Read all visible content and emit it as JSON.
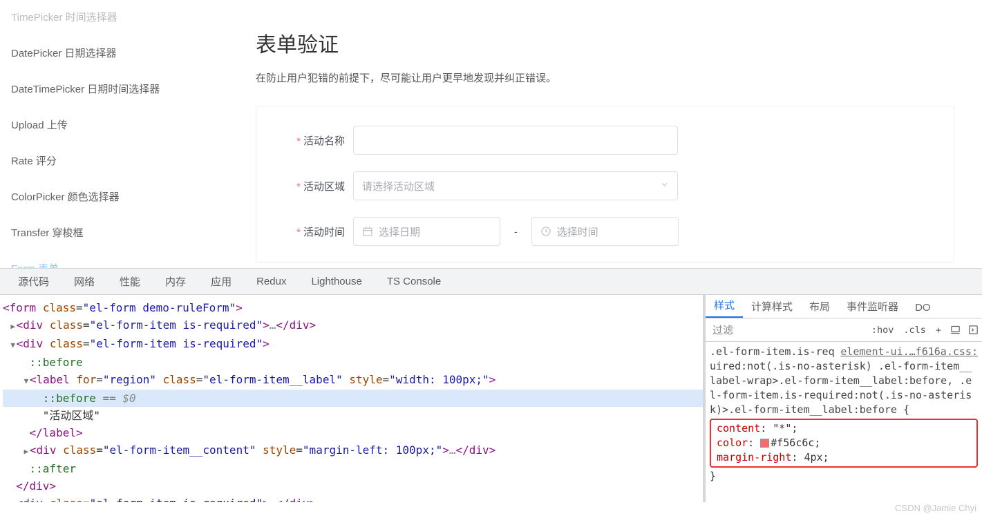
{
  "sidebar": {
    "items": [
      {
        "label": "TimePicker 时间选择器",
        "active": false,
        "faded": true
      },
      {
        "label": "DatePicker 日期选择器",
        "active": false,
        "faded": false
      },
      {
        "label": "DateTimePicker 日期时间选择器",
        "active": false,
        "faded": false
      },
      {
        "label": "Upload 上传",
        "active": false,
        "faded": false
      },
      {
        "label": "Rate 评分",
        "active": false,
        "faded": false
      },
      {
        "label": "ColorPicker 颜色选择器",
        "active": false,
        "faded": false
      },
      {
        "label": "Transfer 穿梭框",
        "active": false,
        "faded": false
      },
      {
        "label": "Form 表单",
        "active": true,
        "faded": false
      }
    ]
  },
  "main": {
    "title": "表单验证",
    "desc": "在防止用户犯错的前提下，尽可能让用户更早地发现并纠正错误。",
    "form": {
      "name_label": "活动名称",
      "region_label": "活动区域",
      "region_placeholder": "请选择活动区域",
      "time_label": "活动时间",
      "date_placeholder": "选择日期",
      "time_placeholder": "选择时间",
      "dash": "-"
    }
  },
  "devtools": {
    "tabs": [
      "源代码",
      "网络",
      "性能",
      "内存",
      "应用",
      "Redux",
      "Lighthouse",
      "TS Console"
    ],
    "dom": {
      "l1": {
        "open": "<",
        "tag": "form",
        "sp": " ",
        "a1": "class",
        "eq": "=",
        "v1": "\"el-form demo-ruleForm\"",
        "close": ">"
      },
      "l2": {
        "tri": "▶",
        "open": "<",
        "tag": "div",
        "sp": " ",
        "a1": "class",
        "eq": "=",
        "v1": "\"el-form-item is-required\"",
        "close": ">",
        "dots": "…",
        "copen": "</",
        "ctag": "div",
        "cclose": ">"
      },
      "l3": {
        "tri": "▼",
        "open": "<",
        "tag": "div",
        "sp": " ",
        "a1": "class",
        "eq": "=",
        "v1": "\"el-form-item is-required\"",
        "close": ">"
      },
      "l4": {
        "ps": "::before"
      },
      "l5": {
        "tri": "▼",
        "open": "<",
        "tag": "label",
        "sp": " ",
        "a1": "for",
        "eq": "=",
        "v1": "\"region\"",
        "sp2": " ",
        "a2": "class",
        "v2": "\"el-form-item__label\"",
        "sp3": " ",
        "a3": "style",
        "v3": "\"width: 100px;\"",
        "close": ">"
      },
      "l6": {
        "ps": "::before",
        "eq": " == ",
        "sel": "$0"
      },
      "l7": {
        "txt": "\"活动区域\""
      },
      "l8": {
        "copen": "</",
        "ctag": "label",
        "cclose": ">"
      },
      "l9": {
        "tri": "▶",
        "open": "<",
        "tag": "div",
        "sp": " ",
        "a1": "class",
        "eq": "=",
        "v1": "\"el-form-item__content\"",
        "sp2": " ",
        "a2": "style",
        "v2": "\"margin-left: 100px;\"",
        "close": ">",
        "dots": "…",
        "copen": "</",
        "ctag": "div",
        "cclose": ">"
      },
      "l10": {
        "ps": "::after"
      },
      "l11": {
        "copen": "</",
        "ctag": "div",
        "cclose": ">"
      },
      "l12": {
        "tri": "▶",
        "open": "<",
        "tag": "div",
        "sp": " ",
        "a1": "class",
        "eq": "=",
        "v1": "\"el-form-item is-required\"",
        "close": ">",
        "dots": "…",
        "copen": "</",
        "ctag": "div",
        "cclose": ">"
      }
    },
    "styles": {
      "tabs": [
        "样式",
        "计算样式",
        "布局",
        "事件监听器",
        "DO"
      ],
      "filter": "过滤",
      "hov": ":hov",
      "cls": ".cls",
      "plus": "+",
      "link": "element-ui.…f616a.css:",
      "selector": ".el-form-item.is-required:not(.is-no-asterisk) .el-form-item__label-wrap>.el-form-item__label:before, .el-form-item.is-required:not(.is-no-asterisk)>.el-form-item__label:before {",
      "rules": [
        {
          "prop": "content",
          "val": "\"*\";"
        },
        {
          "prop": "color",
          "val": "#f56c6c;",
          "swatch": true
        },
        {
          "prop": "margin-right",
          "val": "4px;"
        }
      ],
      "closeBrace": "}"
    }
  },
  "watermark": "CSDN @Jamie Chyi"
}
